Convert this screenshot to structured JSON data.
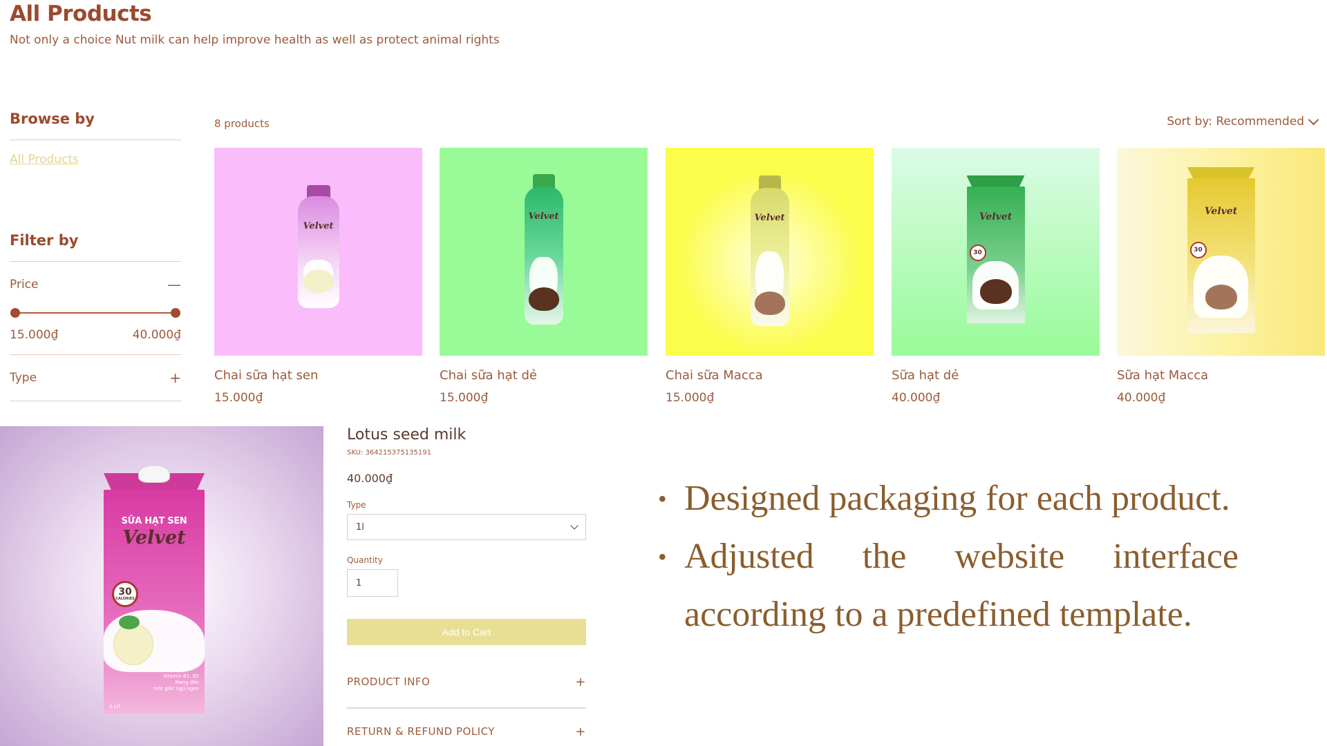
{
  "header": {
    "title": "All Products",
    "subtitle": "Not only a choice Nut milk can help improve health as well as protect animal rights"
  },
  "sidebar": {
    "browse_heading": "Browse by",
    "browse_link": "All Products",
    "filter_heading": "Filter by",
    "price_label": "Price",
    "price_toggle": "—",
    "price_min": "15.000₫",
    "price_max": "40.000₫",
    "type_label": "Type",
    "type_toggle": "+"
  },
  "listing": {
    "count": "8 products",
    "sort_label": "Sort by: Recommended"
  },
  "products": [
    {
      "name": "Chai sữa hạt sen",
      "price": "15.000₫",
      "bg": "#fbbcfb"
    },
    {
      "name": "Chai sữa hạt dẻ",
      "price": "15.000₫",
      "bg": "#98fb98"
    },
    {
      "name": "Chai sữa Macca",
      "price": "15.000₫",
      "bg": "#fcfc4a"
    },
    {
      "name": "Sữa hạt dẻ",
      "price": "40.000₫",
      "bg": "#98fb98"
    },
    {
      "name": "Sữa hạt Macca",
      "price": "40.000₫",
      "bg": "#fcf3a6"
    }
  ],
  "detail": {
    "title": "Lotus seed milk",
    "sku": "SKU: 364215375135191",
    "price": "40.000₫",
    "type_label": "Type",
    "type_value": "1l",
    "quantity_label": "Quantity",
    "quantity_value": "1",
    "add_to_cart": "Add to Cart",
    "product_info": "PRODUCT INFO",
    "return_policy": "RETURN & REFUND POLICY",
    "toggle": "+",
    "packaging": {
      "brand_top": "SỮA HẠT SEN",
      "brand": "Velvet",
      "calories": "30",
      "calories_unit": "CALORIES",
      "vitamin_text": "Vitamin B1, B2\nMang đến\nmột giấc ngủ ngon",
      "size": "1 LÍT"
    }
  },
  "slide": {
    "bullets": [
      "Designed packaging for each product.",
      "Adjusted the website interface according to a predefined template."
    ]
  }
}
